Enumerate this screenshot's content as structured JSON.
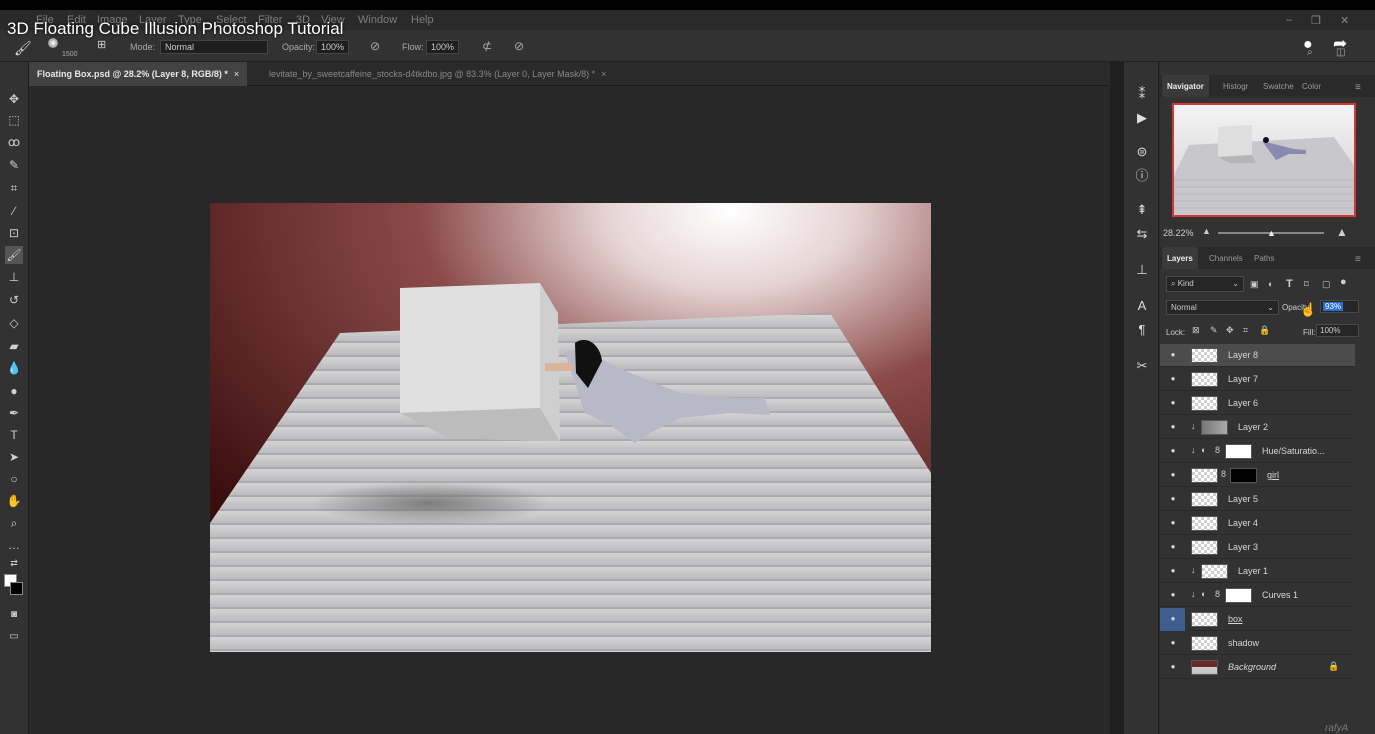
{
  "video_title": "3D Floating Cube Illusion Photoshop Tutorial",
  "menu": [
    "File",
    "Edit",
    "Image",
    "Layer",
    "Type",
    "Select",
    "Filter",
    "3D",
    "View",
    "Window",
    "Help"
  ],
  "options_bar": {
    "brush_size": "1500",
    "mode_label": "Mode:",
    "mode_value": "Normal",
    "opacity_label": "Opacity:",
    "opacity_value": "100%",
    "flow_label": "Flow:",
    "flow_value": "100%"
  },
  "tabs": [
    {
      "label": "Floating Box.psd @ 28.2% (Layer 8, RGB/8) *",
      "close": "×"
    },
    {
      "label": "levitate_by_sweetcaffeine_stocks-d4tkdbo.jpg @ 83.3% (Layer 0, Layer Mask/8) *",
      "close": "×"
    }
  ],
  "navigator_tabs": [
    "Navigator",
    "Histogr",
    "Swatche",
    "Color"
  ],
  "navigator_zoom": "28.22%",
  "layers_tabs": [
    "Layers",
    "Channels",
    "Paths"
  ],
  "layers_panel": {
    "filter_label": "Kind",
    "blend_mode": "Normal",
    "opacity_label": "Opacity:",
    "opacity_value": "93%",
    "lock_label": "Lock:",
    "fill_label": "Fill:",
    "fill_value": "100%"
  },
  "layers": [
    {
      "name": "Layer 8",
      "selected": true,
      "thumb": "checker"
    },
    {
      "name": "Layer 7",
      "selected": false,
      "thumb": "checker"
    },
    {
      "name": "Layer 6",
      "selected": false,
      "thumb": "checker"
    },
    {
      "name": "Layer 2",
      "selected": false,
      "thumb": "grey",
      "clip": true
    },
    {
      "name": "Hue/Saturatio...",
      "selected": false,
      "thumb": "white",
      "clip": true,
      "adjust": true
    },
    {
      "name": "girl",
      "selected": false,
      "thumb": "checker",
      "mask": "black"
    },
    {
      "name": "Layer 5",
      "selected": false,
      "thumb": "checker"
    },
    {
      "name": "Layer 4",
      "selected": false,
      "thumb": "checker"
    },
    {
      "name": "Layer 3",
      "selected": false,
      "thumb": "checker"
    },
    {
      "name": "Layer 1",
      "selected": false,
      "thumb": "checker",
      "clip": true
    },
    {
      "name": "Curves 1",
      "selected": false,
      "thumb": "white",
      "clip": true,
      "adjust": true
    },
    {
      "name": "box",
      "selected": false,
      "thumb": "checker",
      "eye_highlight": true
    },
    {
      "name": "shadow",
      "selected": false,
      "thumb": "checker"
    },
    {
      "name": "Background",
      "selected": false,
      "thumb": "photo",
      "locked": true
    }
  ],
  "watermark": "rafyA",
  "colors": {
    "accent_red": "#d53636",
    "selection": "#4c4c4c",
    "eye_highlight": "#3d5e8e"
  }
}
